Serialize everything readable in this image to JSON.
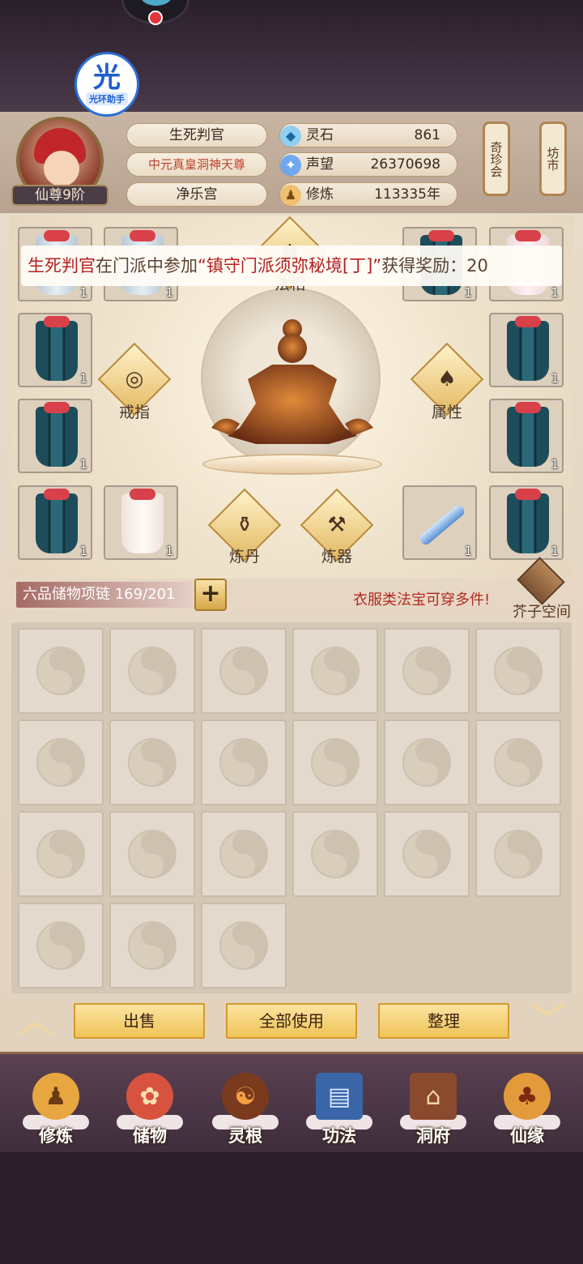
{
  "assistant": {
    "glyph": "光",
    "label": "光环助手"
  },
  "player": {
    "rank": "仙尊9阶",
    "name": "生死判官",
    "title": "中元真皇洞神天尊",
    "sect": "净乐宫"
  },
  "stats": [
    {
      "icon": "spirit-stone-icon",
      "label": "灵石",
      "value": "861"
    },
    {
      "icon": "reputation-icon",
      "label": "声望",
      "value": "26370698"
    },
    {
      "icon": "cultivation-icon",
      "label": "修炼",
      "value": "113335年"
    }
  ],
  "side_buttons": {
    "treasure": "奇珍会",
    "market": "坊市"
  },
  "broadcast": {
    "part1": "生死判官",
    "part2": "在门派中参加",
    "part3": "“镇守门派须弥秘境[丁]”",
    "part4": "获得奖励：20"
  },
  "functions": {
    "top": "法相",
    "ring": "戒指",
    "attribute": "属性",
    "alchemy": "炼丹",
    "forge": "炼器"
  },
  "equipment_slots": [
    {
      "count": "1"
    },
    {
      "count": "1"
    },
    {
      "count": "1"
    },
    {
      "count": "1"
    },
    {
      "count": "1"
    },
    {
      "count": "1"
    },
    {
      "count": "1"
    },
    {
      "count": "1"
    },
    {
      "count": "1"
    },
    {
      "count": "1"
    },
    {
      "count": "1"
    },
    {
      "count": "1"
    }
  ],
  "storage": {
    "label": "六品储物项链 169/201"
  },
  "tip": "衣服类法宝可穿多件!",
  "jiezi": "芥子空间",
  "actions": {
    "sell": "出售",
    "use_all": "全部使用",
    "sort": "整理"
  },
  "nav": [
    {
      "label": "修炼",
      "icon": "cultivation-nav-icon"
    },
    {
      "label": "储物",
      "icon": "storage-bag-icon"
    },
    {
      "label": "灵根",
      "icon": "spirit-root-icon"
    },
    {
      "label": "功法",
      "icon": "skill-book-icon"
    },
    {
      "label": "洞府",
      "icon": "cave-house-icon"
    },
    {
      "label": "仙缘",
      "icon": "gourd-icon"
    }
  ]
}
